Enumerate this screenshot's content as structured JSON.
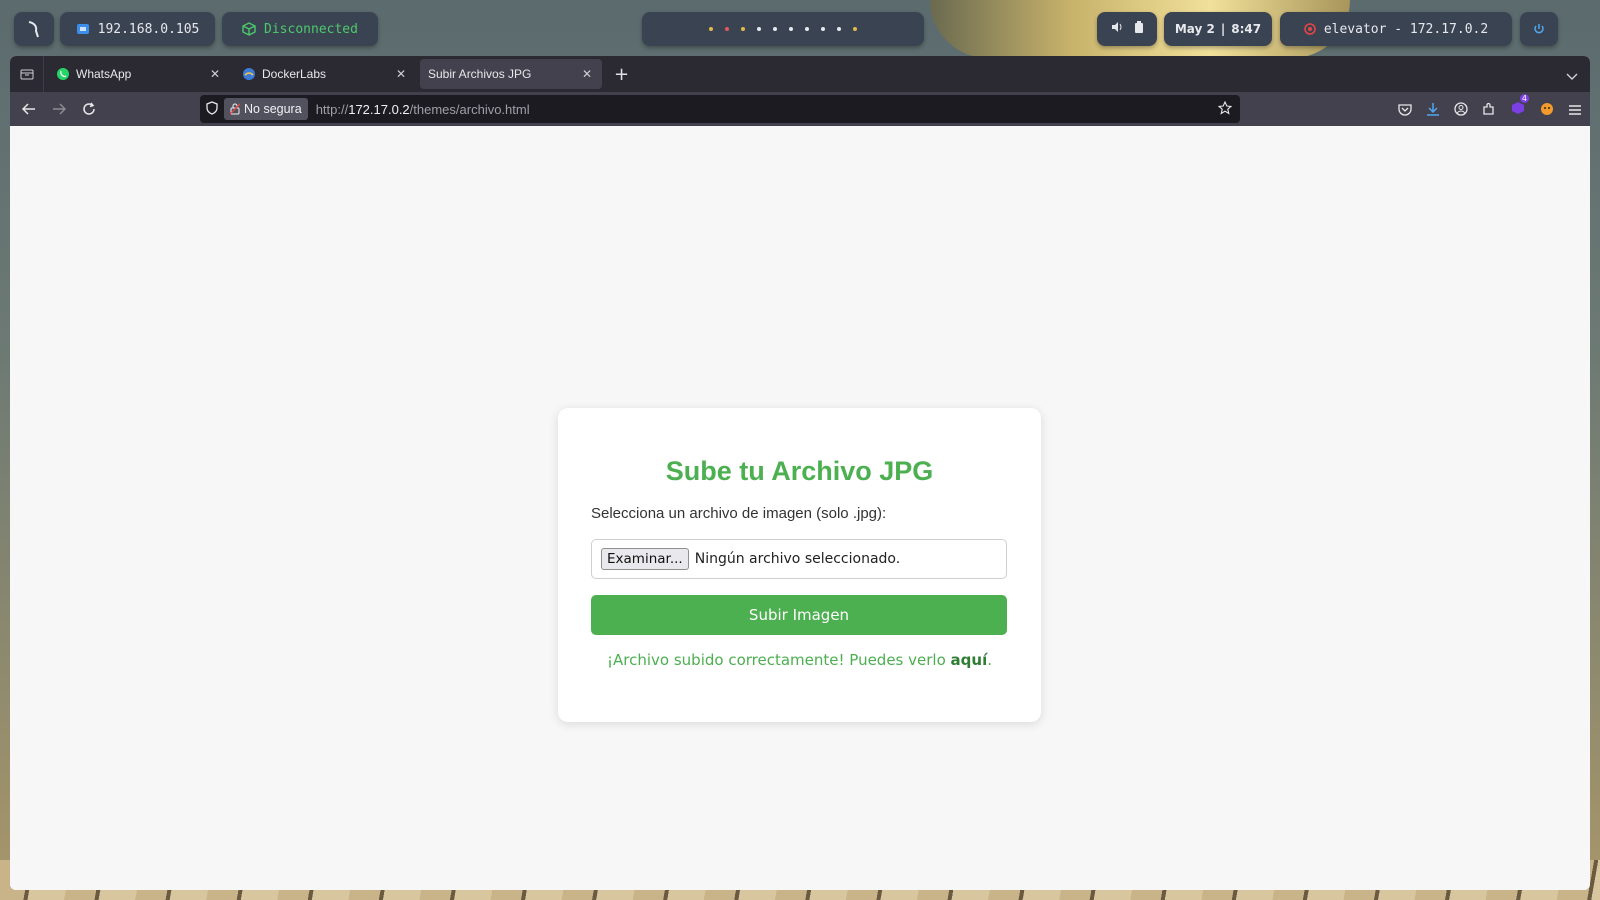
{
  "panel": {
    "ip": "192.168.0.105",
    "vpn_status": "Disconnected",
    "date": "May 2",
    "sep": "|",
    "time": "8:47",
    "target": "elevator - 172.17.0.2",
    "workspace_dot_colors": [
      "#e5b84c",
      "#e05a5a",
      "#e5b84c",
      "#e6e8ec",
      "#e6e8ec",
      "#e6e8ec",
      "#e6e8ec",
      "#e6e8ec",
      "#e6e8ec",
      "#e5b84c"
    ]
  },
  "browser": {
    "tabs": [
      {
        "label": "WhatsApp",
        "icon": "whatsapp-icon"
      },
      {
        "label": "DockerLabs",
        "icon": "dockerlabs-icon"
      },
      {
        "label": "Subir Archivos JPG",
        "icon": ""
      }
    ],
    "active_tab": 2,
    "security_label": "No segura",
    "url_prefix": "http://",
    "url_host": "172.17.0.2",
    "url_path": "/themes/archivo.html",
    "extension_badge": "4"
  },
  "page": {
    "title": "Sube tu Archivo JPG",
    "select_label": "Selecciona un archivo de imagen (solo .jpg):",
    "browse_button": "Examinar...",
    "no_file": "Ningún archivo seleccionado.",
    "submit_button": "Subir Imagen",
    "success_text": "¡Archivo subido correctamente! Puedes verlo ",
    "success_link": "aquí",
    "success_end": ".",
    "accent_color": "#4caf50"
  }
}
